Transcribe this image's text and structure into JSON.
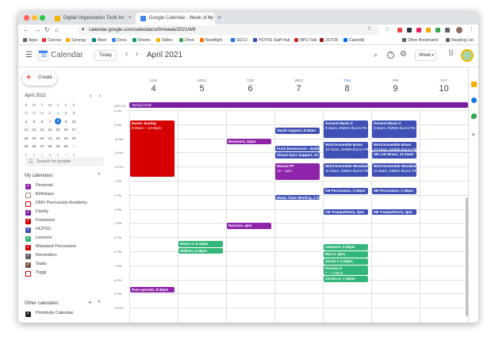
{
  "browser": {
    "tabs": [
      {
        "title": "Digital Organization Tools for ·",
        "active": false
      },
      {
        "title": "Google Calendar - Week of Ap",
        "active": true
      }
    ],
    "new_tab": "+",
    "url": "calendar.google.com/calendar/u/0/r/week/2021/4/8",
    "bookmarks": [
      "Apps",
      "Canvas",
      "Synergy",
      "Meet",
      "Docs",
      "Sheets",
      "Slides",
      "Drive",
      "Noteflight",
      "SECU",
      "HCPSS Staff Hub",
      "MPU Talk",
      "JSTOR",
      "Calendly"
    ],
    "other_bookmarks": "Other Bookmarks",
    "reading_list": "Reading List"
  },
  "header": {
    "app_name": "Calendar",
    "today_button": "Today",
    "month_label": "April 2021",
    "view_select": "Week"
  },
  "sidebar": {
    "create_button": "Create",
    "mini_calendar": {
      "title": "April 2021",
      "weekday_headers": [
        "S",
        "M",
        "T",
        "W",
        "T",
        "F",
        "S"
      ],
      "weeks": [
        [
          "28",
          "29",
          "30",
          "31",
          "1",
          "2",
          "3"
        ],
        [
          "4",
          "5",
          "6",
          "7",
          "8",
          "9",
          "10"
        ],
        [
          "11",
          "12",
          "13",
          "14",
          "15",
          "16",
          "17"
        ],
        [
          "18",
          "19",
          "20",
          "21",
          "22",
          "23",
          "24"
        ],
        [
          "25",
          "26",
          "27",
          "28",
          "29",
          "30",
          "1"
        ],
        [
          "2",
          "3",
          "4",
          "5",
          "6",
          "7",
          "8"
        ]
      ],
      "today": "1",
      "selected": "8"
    },
    "search_people_placeholder": "Search for people",
    "my_calendars_heading": "My calendars",
    "my_calendars": [
      {
        "name": "Personal",
        "color": "#8e24aa",
        "checked": true
      },
      {
        "name": "Birthdays",
        "color": "#a1887f",
        "checked": false
      },
      {
        "name": "DMV Percussion Academy",
        "color": "#d50000",
        "checked": false
      },
      {
        "name": "Family",
        "color": "#7b1fa2",
        "checked": true
      },
      {
        "name": "Freelance",
        "color": "#d50000",
        "checked": true
      },
      {
        "name": "HCPSS",
        "color": "#3f51b5",
        "checked": true
      },
      {
        "name": "Lessons",
        "color": "#33b679",
        "checked": true
      },
      {
        "name": "Maryland Percussion",
        "color": "#d50000",
        "checked": true
      },
      {
        "name": "Reminders",
        "color": "#616161",
        "checked": true
      },
      {
        "name": "Tasks",
        "color": "#795548",
        "checked": true
      },
      {
        "name": "Toggl",
        "color": "#d50000",
        "checked": false
      }
    ],
    "other_calendars_heading": "Other calendars",
    "other_calendars": [
      {
        "name": "Primitivity Calendar",
        "color": "#202124",
        "checked": true
      }
    ]
  },
  "week": {
    "timezone": "GMT-04",
    "days": [
      {
        "name": "SUN",
        "num": "4"
      },
      {
        "name": "MON",
        "num": "5"
      },
      {
        "name": "TUE",
        "num": "6"
      },
      {
        "name": "WED",
        "num": "7"
      },
      {
        "name": "THU",
        "num": "8",
        "today": true
      },
      {
        "name": "FRI",
        "num": "9"
      },
      {
        "name": "SAT",
        "num": "10"
      }
    ],
    "allday_event": "Spring break",
    "time_labels": [
      "8 AM",
      "9 AM",
      "10 AM",
      "11 AM",
      "12 PM",
      "1 PM",
      "2 PM",
      "3 PM",
      "4 PM",
      "5 PM",
      "6 PM",
      "7 PM",
      "8 PM",
      "9 PM",
      "10 PM"
    ],
    "events": [
      {
        "day": 0,
        "start": 8.75,
        "end": 12.75,
        "title": "Easter Sunday",
        "time": "8:45am – 12:45pm",
        "color": "#d50000"
      },
      {
        "day": 0,
        "start": 20.5,
        "end": 21.0,
        "title": "Post episode, 8:30pm",
        "time": "",
        "color": "#8e24aa"
      },
      {
        "day": 1,
        "start": 17.25,
        "end": 17.75,
        "title": "Henry A, 5:15pm",
        "time": "",
        "color": "#33b679"
      },
      {
        "day": 1,
        "start": 17.75,
        "end": 18.25,
        "title": "William, 5:45pm",
        "time": "",
        "color": "#33b679"
      },
      {
        "day": 2,
        "start": 10.0,
        "end": 10.5,
        "title": "Benavent, 10am",
        "time": "",
        "color": "#8e24aa"
      },
      {
        "day": 2,
        "start": 16.0,
        "end": 16.5,
        "title": "Ryerson, 4pm",
        "time": "",
        "color": "#8e24aa"
      },
      {
        "day": 3,
        "start": 9.25,
        "end": 9.75,
        "title": "Jacob support, 9:15am",
        "time": "",
        "color": "#3f51b5"
      },
      {
        "day": 3,
        "start": 10.5,
        "end": 11.0,
        "title": "FLEX [Homeroom - Buildi",
        "time": "",
        "color": "#3f51b5"
      },
      {
        "day": 3,
        "start": 11.0,
        "end": 11.5,
        "title": "Virtual Sync Support, 11:",
        "time": "",
        "color": "#3f51b5"
      },
      {
        "day": 3,
        "start": 11.75,
        "end": 13.0,
        "title": "Dianne PT",
        "time": "12 – 1pm",
        "color": "#8e24aa"
      },
      {
        "day": 3,
        "start": 14.0,
        "end": 14.35,
        "title": "Music Team Meeting, 2:15",
        "time": "",
        "color": "#3f51b5"
      },
      {
        "day": 4,
        "start": 8.75,
        "end": 10.0,
        "title": "General Music II",
        "time": "8:45am, EMMS-Iburns-PE",
        "color": "#3f51b5"
      },
      {
        "day": 4,
        "start": 10.25,
        "end": 11.5,
        "title": "Wind Ensemble Brass",
        "time": "10:15am, EMMS-Iburns-PE",
        "color": "#3f51b5"
      },
      {
        "day": 4,
        "start": 11.75,
        "end": 12.75,
        "title": "Wind Ensemble Woodwinds",
        "time": "11:45am, EMMS-Iburns-PE",
        "color": "#3f51b5"
      },
      {
        "day": 4,
        "start": 13.5,
        "end": 14.0,
        "title": "CB Percussion, 1:30pm",
        "time": "",
        "color": "#3f51b5"
      },
      {
        "day": 4,
        "start": 15.0,
        "end": 15.5,
        "title": "CB Trumpet/Horn, 3pm",
        "time": "",
        "color": "#3f51b5"
      },
      {
        "day": 4,
        "start": 17.5,
        "end": 18.0,
        "title": "Jameson, 5:30pm",
        "time": "",
        "color": "#33b679"
      },
      {
        "day": 4,
        "start": 18.0,
        "end": 18.5,
        "title": "Max K, 6pm",
        "time": "",
        "color": "#33b679"
      },
      {
        "day": 4,
        "start": 18.5,
        "end": 19.0,
        "title": "Jacob T, 6:30pm",
        "time": "",
        "color": "#33b679"
      },
      {
        "day": 4,
        "start": 19.0,
        "end": 19.75,
        "title": "Preston H",
        "time": "7 – 7:45pm",
        "color": "#33b679"
      },
      {
        "day": 4,
        "start": 19.75,
        "end": 20.25,
        "title": "Jordan K, 7:45pm",
        "time": "",
        "color": "#33b679"
      },
      {
        "day": 5,
        "start": 8.75,
        "end": 10.0,
        "title": "General Music II",
        "time": "8:45am, EMMS-Iburns-PE",
        "color": "#3f51b5"
      },
      {
        "day": 5,
        "start": 10.25,
        "end": 10.9,
        "title": "Wind Ensemble Brass",
        "time": "10:15am, EMMS-Iburns-PE",
        "color": "#3f51b5"
      },
      {
        "day": 5,
        "start": 10.9,
        "end": 11.5,
        "title": "SB Low Brass, 11:15am",
        "time": "",
        "color": "#3f51b5"
      },
      {
        "day": 5,
        "start": 11.75,
        "end": 12.75,
        "title": "Wind Ensemble Woodwinds",
        "time": "11:45am, EMMS-Iburns-PE",
        "color": "#3f51b5"
      },
      {
        "day": 5,
        "start": 13.5,
        "end": 14.0,
        "title": "SB Percussion, 1:30pm",
        "time": "",
        "color": "#3f51b5"
      },
      {
        "day": 5,
        "start": 15.0,
        "end": 15.5,
        "title": "SB Trumpet/Horn, 3pm",
        "time": "",
        "color": "#3f51b5"
      }
    ]
  }
}
